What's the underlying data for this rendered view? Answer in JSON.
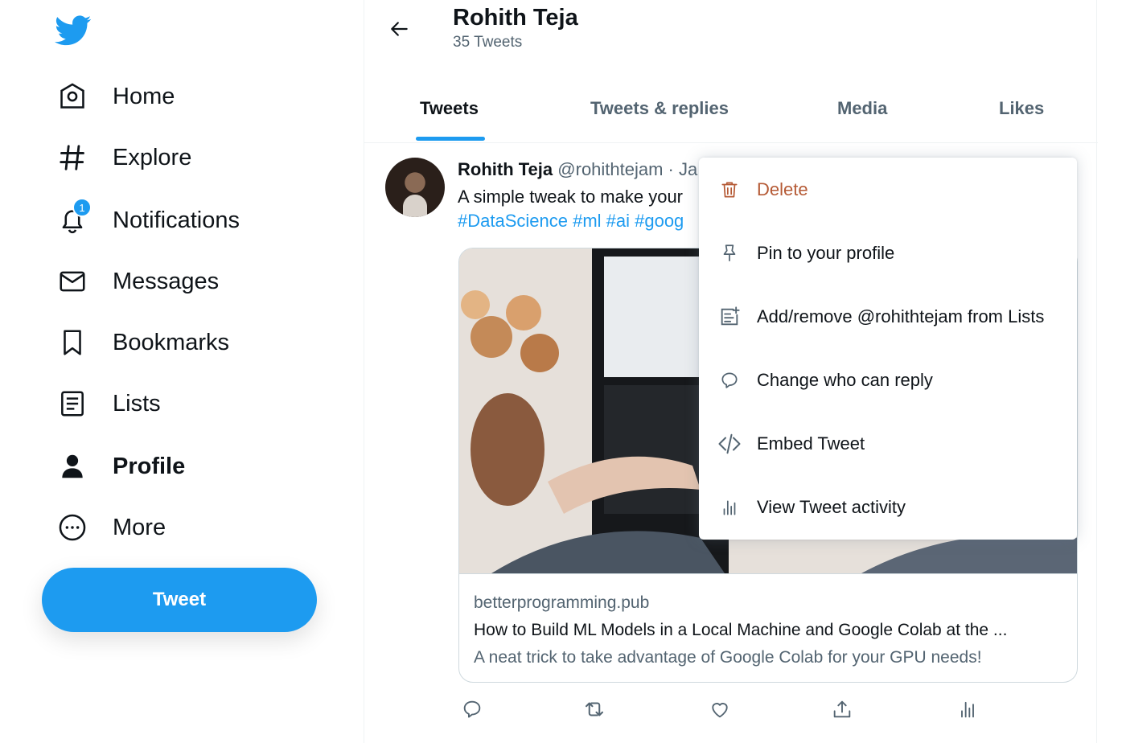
{
  "sidebar": {
    "items": [
      {
        "label": "Home",
        "icon": "home-icon"
      },
      {
        "label": "Explore",
        "icon": "hashtag-icon"
      },
      {
        "label": "Notifications",
        "icon": "bell-icon",
        "badge": "1"
      },
      {
        "label": "Messages",
        "icon": "envelope-icon"
      },
      {
        "label": "Bookmarks",
        "icon": "bookmark-icon"
      },
      {
        "label": "Lists",
        "icon": "list-icon"
      },
      {
        "label": "Profile",
        "icon": "person-icon"
      },
      {
        "label": "More",
        "icon": "more-circle-icon"
      }
    ],
    "tweet_button": "Tweet"
  },
  "header": {
    "name": "Rohith Teja",
    "tweet_count": "35 Tweets"
  },
  "tabs": [
    {
      "label": "Tweets",
      "active": true
    },
    {
      "label": "Tweets & replies"
    },
    {
      "label": "Media"
    },
    {
      "label": "Likes"
    }
  ],
  "tweet": {
    "author": "Rohith Teja",
    "handle": "@rohithtejam · Ja",
    "text": "A simple tweak to make your",
    "hashtags": "#DataScience #ml #ai #goog",
    "card": {
      "domain": "betterprogramming.pub",
      "title": "How to Build ML Models in a Local Machine and Google Colab at the ...",
      "description": "A neat trick to take advantage of Google Colab for your GPU needs!"
    }
  },
  "menu": {
    "items": [
      {
        "label": "Delete",
        "icon": "trash-icon"
      },
      {
        "label": "Pin to your profile",
        "icon": "pin-icon"
      },
      {
        "label": "Add/remove @rohithtejam from Lists",
        "icon": "list-add-icon"
      },
      {
        "label": "Change who can reply",
        "icon": "speech-bubble-icon"
      },
      {
        "label": "Embed Tweet",
        "icon": "code-icon"
      },
      {
        "label": "View Tweet activity",
        "icon": "activity-icon"
      }
    ]
  },
  "colors": {
    "accent": "#1d9bf0",
    "danger": "#b55a35",
    "text": "#0f1419",
    "muted": "#536471"
  }
}
